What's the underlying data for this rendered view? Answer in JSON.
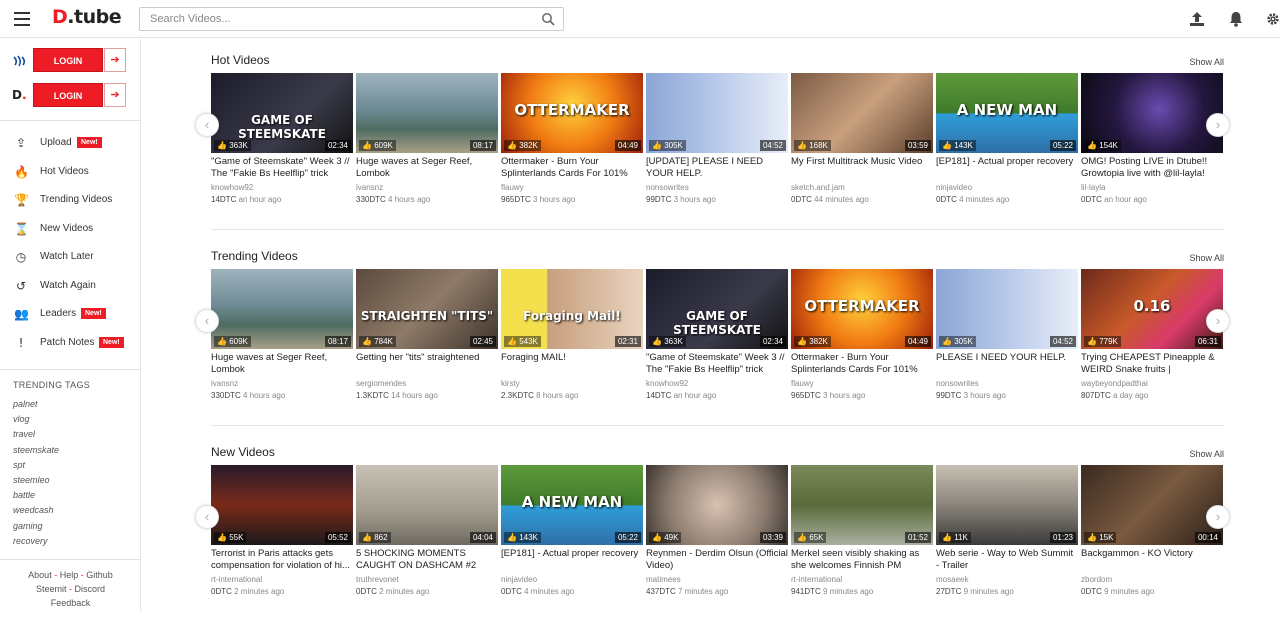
{
  "header": {
    "logo_a": "D",
    "logo_b": ".tube",
    "search_placeholder": "Search Videos..."
  },
  "sidebar": {
    "login_label": "LOGIN",
    "nav": [
      {
        "label": "Upload",
        "badge": "New!",
        "icon": "upload-icon"
      },
      {
        "label": "Hot Videos",
        "badge": "",
        "icon": "fire-icon"
      },
      {
        "label": "Trending Videos",
        "badge": "",
        "icon": "trophy-icon"
      },
      {
        "label": "New Videos",
        "badge": "",
        "icon": "hourglass-icon"
      },
      {
        "label": "Watch Later",
        "badge": "",
        "icon": "clock-icon"
      },
      {
        "label": "Watch Again",
        "badge": "",
        "icon": "history-icon"
      },
      {
        "label": "Leaders",
        "badge": "New!",
        "icon": "users-icon"
      },
      {
        "label": "Patch Notes",
        "badge": "New!",
        "icon": "exclamation-icon"
      }
    ],
    "tags_title": "TRENDING TAGS",
    "tags": [
      "palnet",
      "vlog",
      "travel",
      "steemskate",
      "spt",
      "steemleo",
      "battle",
      "weedcash",
      "gaming",
      "recovery"
    ],
    "footer": {
      "about": "About",
      "help": "Help",
      "github": "Github",
      "steemit": "Steemit",
      "discord": "Discord",
      "feedback": "Feedback",
      "dash": "-"
    }
  },
  "colors": {
    "accent": "#ee1c25"
  },
  "sections": [
    {
      "title": "Hot Videos",
      "show_all": "Show All",
      "videos": [
        {
          "views": "363K",
          "duration": "02:34",
          "title": "\"Game of Steemskate\" Week 3 // The \"Fakie Bs Heelflip\" trick",
          "author": "knowhow92",
          "value": "14DTC",
          "ago": "an hour ago",
          "bg": "linear-gradient(135deg,#1b1b2a,#3a3a4a 60%,#111)",
          "text": "GAME OF STEEMSKATE"
        },
        {
          "views": "609K",
          "duration": "08:17",
          "title": "Huge waves at Seger Reef, Lombok",
          "author": "ivansnz",
          "value": "330DTC",
          "ago": "4 hours ago",
          "bg": "linear-gradient(180deg,#9fb3bd,#6e8b95 45%,#4f6d63 70%,#a89f86)",
          "text": ""
        },
        {
          "views": "382K",
          "duration": "04:49",
          "title": "Ottermaker - Burn Your Splinterlands Cards For 101% DEC",
          "author": "flauwy",
          "value": "965DTC",
          "ago": "3 hours ago",
          "bg": "radial-gradient(circle at 50% 40%,#ffd23c,#f07a12 50%,#9b1f0a)",
          "text": "OTTERMAKER"
        },
        {
          "views": "305K",
          "duration": "04:52",
          "title": "[UPDATE] PLEASE I NEED YOUR HELP.",
          "author": "nonsowrites",
          "value": "99DTC",
          "ago": "3 hours ago",
          "bg": "linear-gradient(90deg,#8aa6d6,#b8c9ea 50%,#e8eef8)",
          "text": ""
        },
        {
          "views": "168K",
          "duration": "03:59",
          "title": "My First Multitrack Music Video",
          "author": "sketch.and.jam",
          "value": "0DTC",
          "ago": "44 minutes ago",
          "bg": "linear-gradient(135deg,#7a5a44,#c9a07e 50%,#5a3d2b)",
          "text": ""
        },
        {
          "views": "143K",
          "duration": "05:22",
          "title": "[EP181] - Actual proper recovery",
          "author": "ninjavideo",
          "value": "0DTC",
          "ago": "4 minutes ago",
          "bg": "linear-gradient(180deg,#5f9a3c,#3f7a2a 50%,#2f9ed8 51%,#2f6fa8)",
          "text": "A NEW MAN"
        },
        {
          "views": "154K",
          "duration": "",
          "title": "OMG! Posting LIVE in Dtube!! Growtopia live with @lil-layla!",
          "author": "lil-layla",
          "value": "0DTC",
          "ago": "an hour ago",
          "bg": "radial-gradient(circle at 55% 45%,#6a4bb0,#24173f 50%,#0a0a12)",
          "text": ""
        }
      ]
    },
    {
      "title": "Trending Videos",
      "show_all": "Show All",
      "videos": [
        {
          "views": "609K",
          "duration": "08:17",
          "title": "Huge waves at Seger Reef, Lombok",
          "author": "ivansnz",
          "value": "330DTC",
          "ago": "4 hours ago",
          "bg": "linear-gradient(180deg,#9fb3bd,#6e8b95 45%,#4f6d63 70%,#a89f86)",
          "text": ""
        },
        {
          "views": "784K",
          "duration": "02:45",
          "title": "Getting her \"tits\" straightened",
          "author": "sergiomendes",
          "value": "1.3KDTC",
          "ago": "14 hours ago",
          "bg": "linear-gradient(135deg,#5b4a3d,#8e7a68 50%,#3d332b)",
          "text": "STRAIGHTEN \"TITS\""
        },
        {
          "views": "543K",
          "duration": "02:31",
          "title": "Foraging MAIL!",
          "author": "kirsty",
          "value": "2.3KDTC",
          "ago": "8 hours ago",
          "bg": "linear-gradient(90deg,#f4e04d,#f4e04d 32%,#c89f7b 33%,#e9d4c0)",
          "text": "Foraging Mail!"
        },
        {
          "views": "363K",
          "duration": "02:34",
          "title": "\"Game of Steemskate\" Week 3 // The \"Fakie Bs Heelflip\" trick",
          "author": "knowhow92",
          "value": "14DTC",
          "ago": "an hour ago",
          "bg": "linear-gradient(135deg,#1b1b2a,#3a3a4a 60%,#111)",
          "text": "GAME OF STEEMSKATE"
        },
        {
          "views": "382K",
          "duration": "04:49",
          "title": "Ottermaker - Burn Your Splinterlands Cards For 101% DEC",
          "author": "flauwy",
          "value": "965DTC",
          "ago": "3 hours ago",
          "bg": "radial-gradient(circle at 50% 40%,#ffd23c,#f07a12 50%,#9b1f0a)",
          "text": "OTTERMAKER"
        },
        {
          "views": "305K",
          "duration": "04:52",
          "title": "PLEASE I NEED YOUR HELP.",
          "author": "nonsowrites",
          "value": "99DTC",
          "ago": "3 hours ago",
          "bg": "linear-gradient(90deg,#8aa6d6,#b8c9ea 50%,#e8eef8)",
          "text": ""
        },
        {
          "views": "779K",
          "duration": "06:31",
          "title": "Trying CHEAPEST Pineapple & WEIRD Snake fruits | Chumphon...",
          "author": "waybeyondpadthai",
          "value": "807DTC",
          "ago": "a day ago",
          "bg": "linear-gradient(135deg,#6b2a1a,#c85a2a 45%,#d83a6a 70%,#3a1a10)",
          "text": "0.16"
        }
      ]
    },
    {
      "title": "New Videos",
      "show_all": "Show All",
      "videos": [
        {
          "views": "55K",
          "duration": "05:52",
          "title": "Terrorist in Paris attacks gets compensation for violation of hi...",
          "author": "rt-international",
          "value": "0DTC",
          "ago": "2 minutes ago",
          "bg": "linear-gradient(180deg,#2a1a2a,#7a2a1a 50%,#1a1a1a)",
          "text": ""
        },
        {
          "views": "862",
          "duration": "04:04",
          "title": "5 SHOCKING MOMENTS CAUGHT ON DASHCAM #2",
          "author": "truthrevonet",
          "value": "0DTC",
          "ago": "2 minutes ago",
          "bg": "linear-gradient(180deg,#c8c2b6,#a19a8c 60%,#6e6a60)",
          "text": ""
        },
        {
          "views": "143K",
          "duration": "05:22",
          "title": "[EP181] - Actual proper recovery",
          "author": "ninjavideo",
          "value": "0DTC",
          "ago": "4 minutes ago",
          "bg": "linear-gradient(180deg,#5f9a3c,#3f7a2a 50%,#2f9ed8 51%,#2f6fa8)",
          "text": "A NEW MAN"
        },
        {
          "views": "49K",
          "duration": "03:39",
          "title": "Reynmen - Derdim Olsun (Official Video)",
          "author": "matimees",
          "value": "437DTC",
          "ago": "7 minutes ago",
          "bg": "radial-gradient(circle at 50% 50%,#d8c2b2,#8a7a6e 60%,#3a3430)",
          "text": ""
        },
        {
          "views": "65K",
          "duration": "01:52",
          "title": "Merkel seen visibly shaking as she welcomes Finnish PM",
          "author": "rt-international",
          "value": "941DTC",
          "ago": "9 minutes ago",
          "bg": "linear-gradient(180deg,#7a8a5a,#5a6a3a 50%,#aab0a0)",
          "text": ""
        },
        {
          "views": "11K",
          "duration": "01:23",
          "title": "Web serie - Way to Web Summit - Trailer",
          "author": "mosaeek",
          "value": "27DTC",
          "ago": "9 minutes ago",
          "bg": "linear-gradient(180deg,#c8c0b4,#8a847a 50%,#3a3a3a)",
          "text": ""
        },
        {
          "views": "15K",
          "duration": "00:14",
          "title": "Backgammon - KO Victory",
          "author": "zbordom",
          "value": "0DTC",
          "ago": "9 minutes ago",
          "bg": "linear-gradient(135deg,#3a2a20,#7a5a40 50%,#2a1e16)",
          "text": ""
        }
      ]
    }
  ]
}
